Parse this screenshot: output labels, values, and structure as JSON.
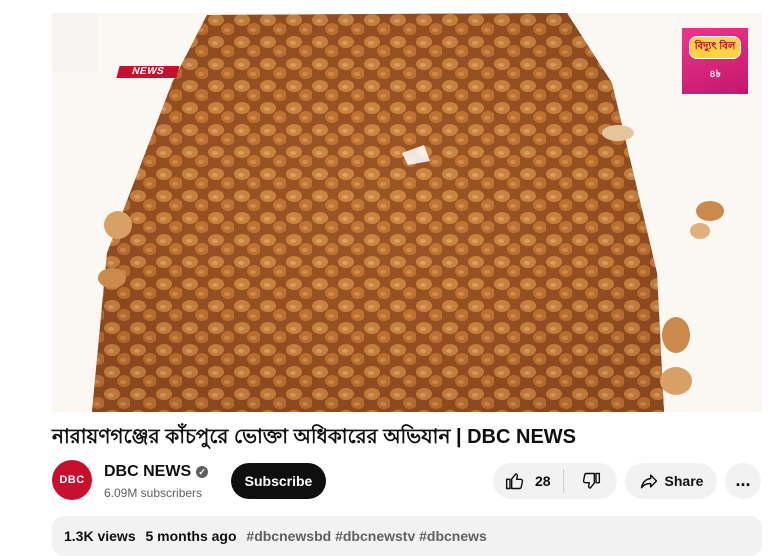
{
  "video": {
    "overlay_tag": "NEWS",
    "promo_title": "বিদ্যুৎ বিল",
    "promo_sub": "৪৳"
  },
  "title": "নারায়ণগঞ্জের কাঁচপুরে ভোক্তা অধিকারের অভিযান | DBC NEWS",
  "channel": {
    "avatar_text": "DBC",
    "name": "DBC NEWS",
    "subscribers": "6.09M subscribers",
    "subscribe_label": "Subscribe"
  },
  "actions": {
    "likes": "28",
    "share_label": "Share",
    "more_label": "..."
  },
  "description": {
    "views": "1.3K views",
    "age": "5 months ago",
    "hashtags": "#dbcnewsbd #dbcnewstv #dbcnews"
  },
  "icons": {
    "like": "thumb-up-icon",
    "dislike": "thumb-down-icon",
    "share": "share-arrow-icon",
    "verified": "verified-check-icon"
  },
  "colors": {
    "brand_red": "#c8102e",
    "promo_pink": "#e0257a",
    "subscribe_bg": "#0f0f0f"
  }
}
